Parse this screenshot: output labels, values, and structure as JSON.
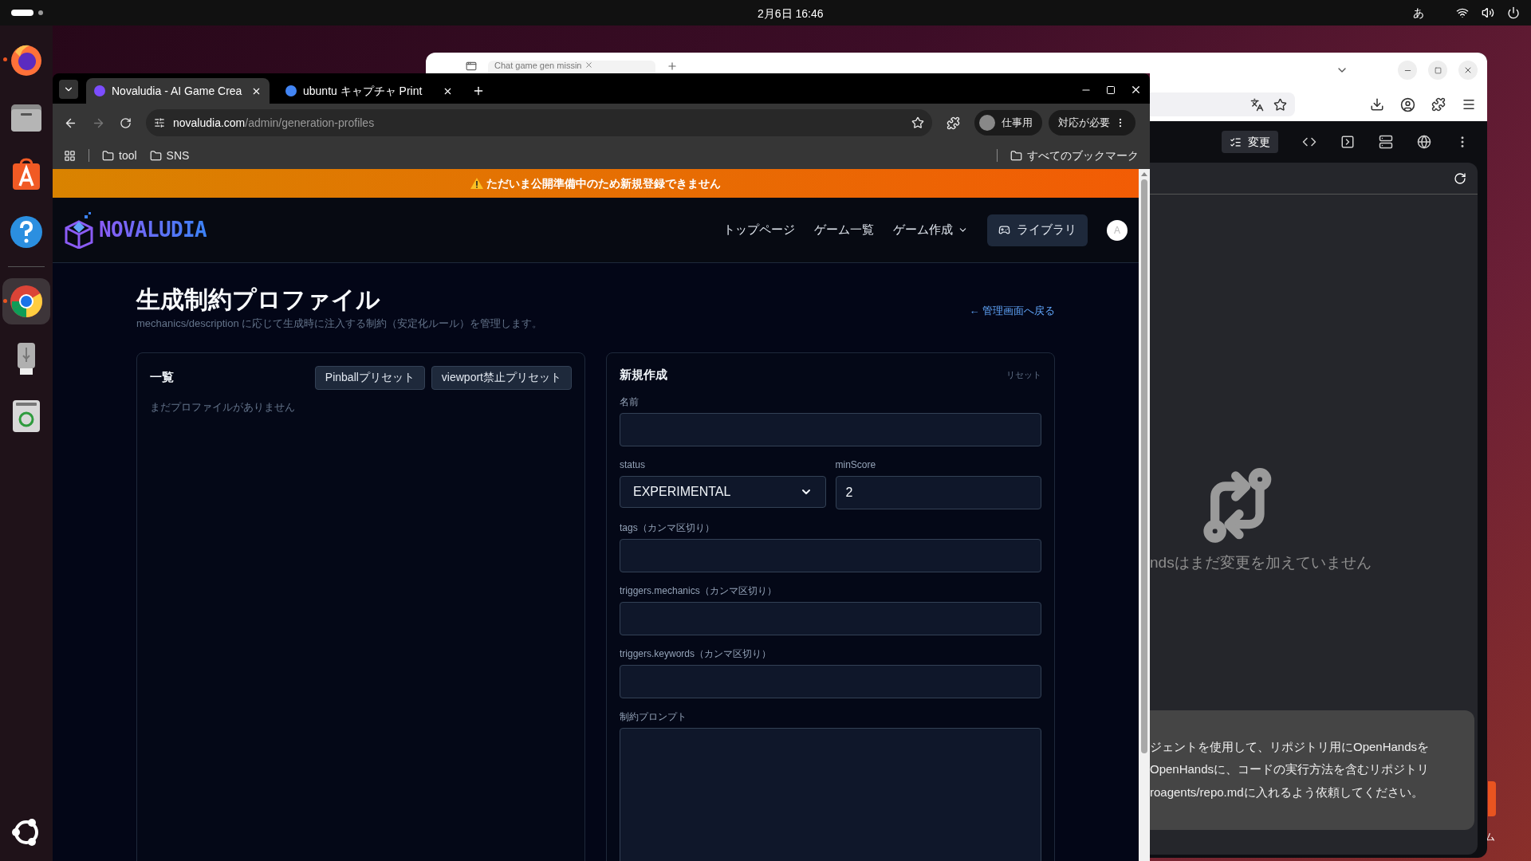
{
  "top_bar": {
    "date_time": "2月6日 16:46",
    "input_method": "あ"
  },
  "dock": [
    {
      "kind": "firefox",
      "running": true,
      "selected": false
    },
    {
      "kind": "files",
      "running": false,
      "selected": false
    },
    {
      "kind": "appcenter",
      "running": false,
      "selected": false
    },
    {
      "kind": "help",
      "running": false,
      "selected": false
    },
    {
      "kind": "chrome",
      "running": true,
      "selected": true
    },
    {
      "kind": "usb",
      "running": false,
      "selected": false
    },
    {
      "kind": "trash",
      "running": false,
      "selected": false
    }
  ],
  "background_window": {
    "tab_title": "Chat game gen missin",
    "changes_tab": {
      "label": "変更",
      "selected": true
    },
    "empty_message": "ndsはまだ変更を加えていません",
    "hint_lines": [
      "ジェントを使用して、リポジトリ用にOpenHandsを",
      "OpenHandsに、コードの実行方法を含むリポジトリ",
      "roagents/repo.mdに入れるよう依頼してください。"
    ]
  },
  "desktop_label": "ム",
  "browser": {
    "tabs": [
      {
        "title": "Novaludia - AI Game Crea",
        "selected": true
      },
      {
        "title": "ubuntu キャプチャ Print",
        "selected": false
      }
    ],
    "forward_disabled": true,
    "url_host": "novaludia.com",
    "url_path": "/admin/generation-profiles",
    "profile": "仕事用",
    "update_button": "対応が必要",
    "bookmarks": [
      "tool",
      "SNS"
    ],
    "all_bookmarks": "すべてのブックマーク"
  },
  "page": {
    "banner": "ただいま公開準備中のため新規登録できません",
    "logo": "NOVALUDIA",
    "nav": [
      {
        "label": "トップページ",
        "dropdown": false
      },
      {
        "label": "ゲーム一覧",
        "dropdown": false
      },
      {
        "label": "ゲーム作成",
        "dropdown": true
      }
    ],
    "library_button": "ライブラリ",
    "avatar": "A",
    "title": "生成制約プロファイル",
    "subtitle": "mechanics/description に応じて生成時に注入する制約（安定化ルール）を管理します。",
    "back_link": "← 管理画面へ戻る",
    "list_card": {
      "title": "一覧",
      "buttons": [
        "Pinballプリセット",
        "viewport禁止プリセット"
      ],
      "empty": "まだプロファイルがありません"
    },
    "form": {
      "title": "新規作成",
      "reset": "リセット",
      "rows": [
        [
          {
            "label": "名前",
            "kind": "text"
          }
        ],
        [
          {
            "label": "status",
            "kind": "select",
            "value": "EXPERIMENTAL"
          },
          {
            "label": "minScore",
            "kind": "text",
            "value": "2"
          }
        ],
        [
          {
            "label": "tags（カンマ区切り）",
            "kind": "text"
          }
        ],
        [
          {
            "label": "triggers.mechanics（カンマ区切り）",
            "kind": "text"
          }
        ],
        [
          {
            "label": "triggers.keywords（カンマ区切り）",
            "kind": "text"
          }
        ],
        [
          {
            "label": "制約プロンプト",
            "kind": "textarea"
          }
        ]
      ]
    }
  }
}
